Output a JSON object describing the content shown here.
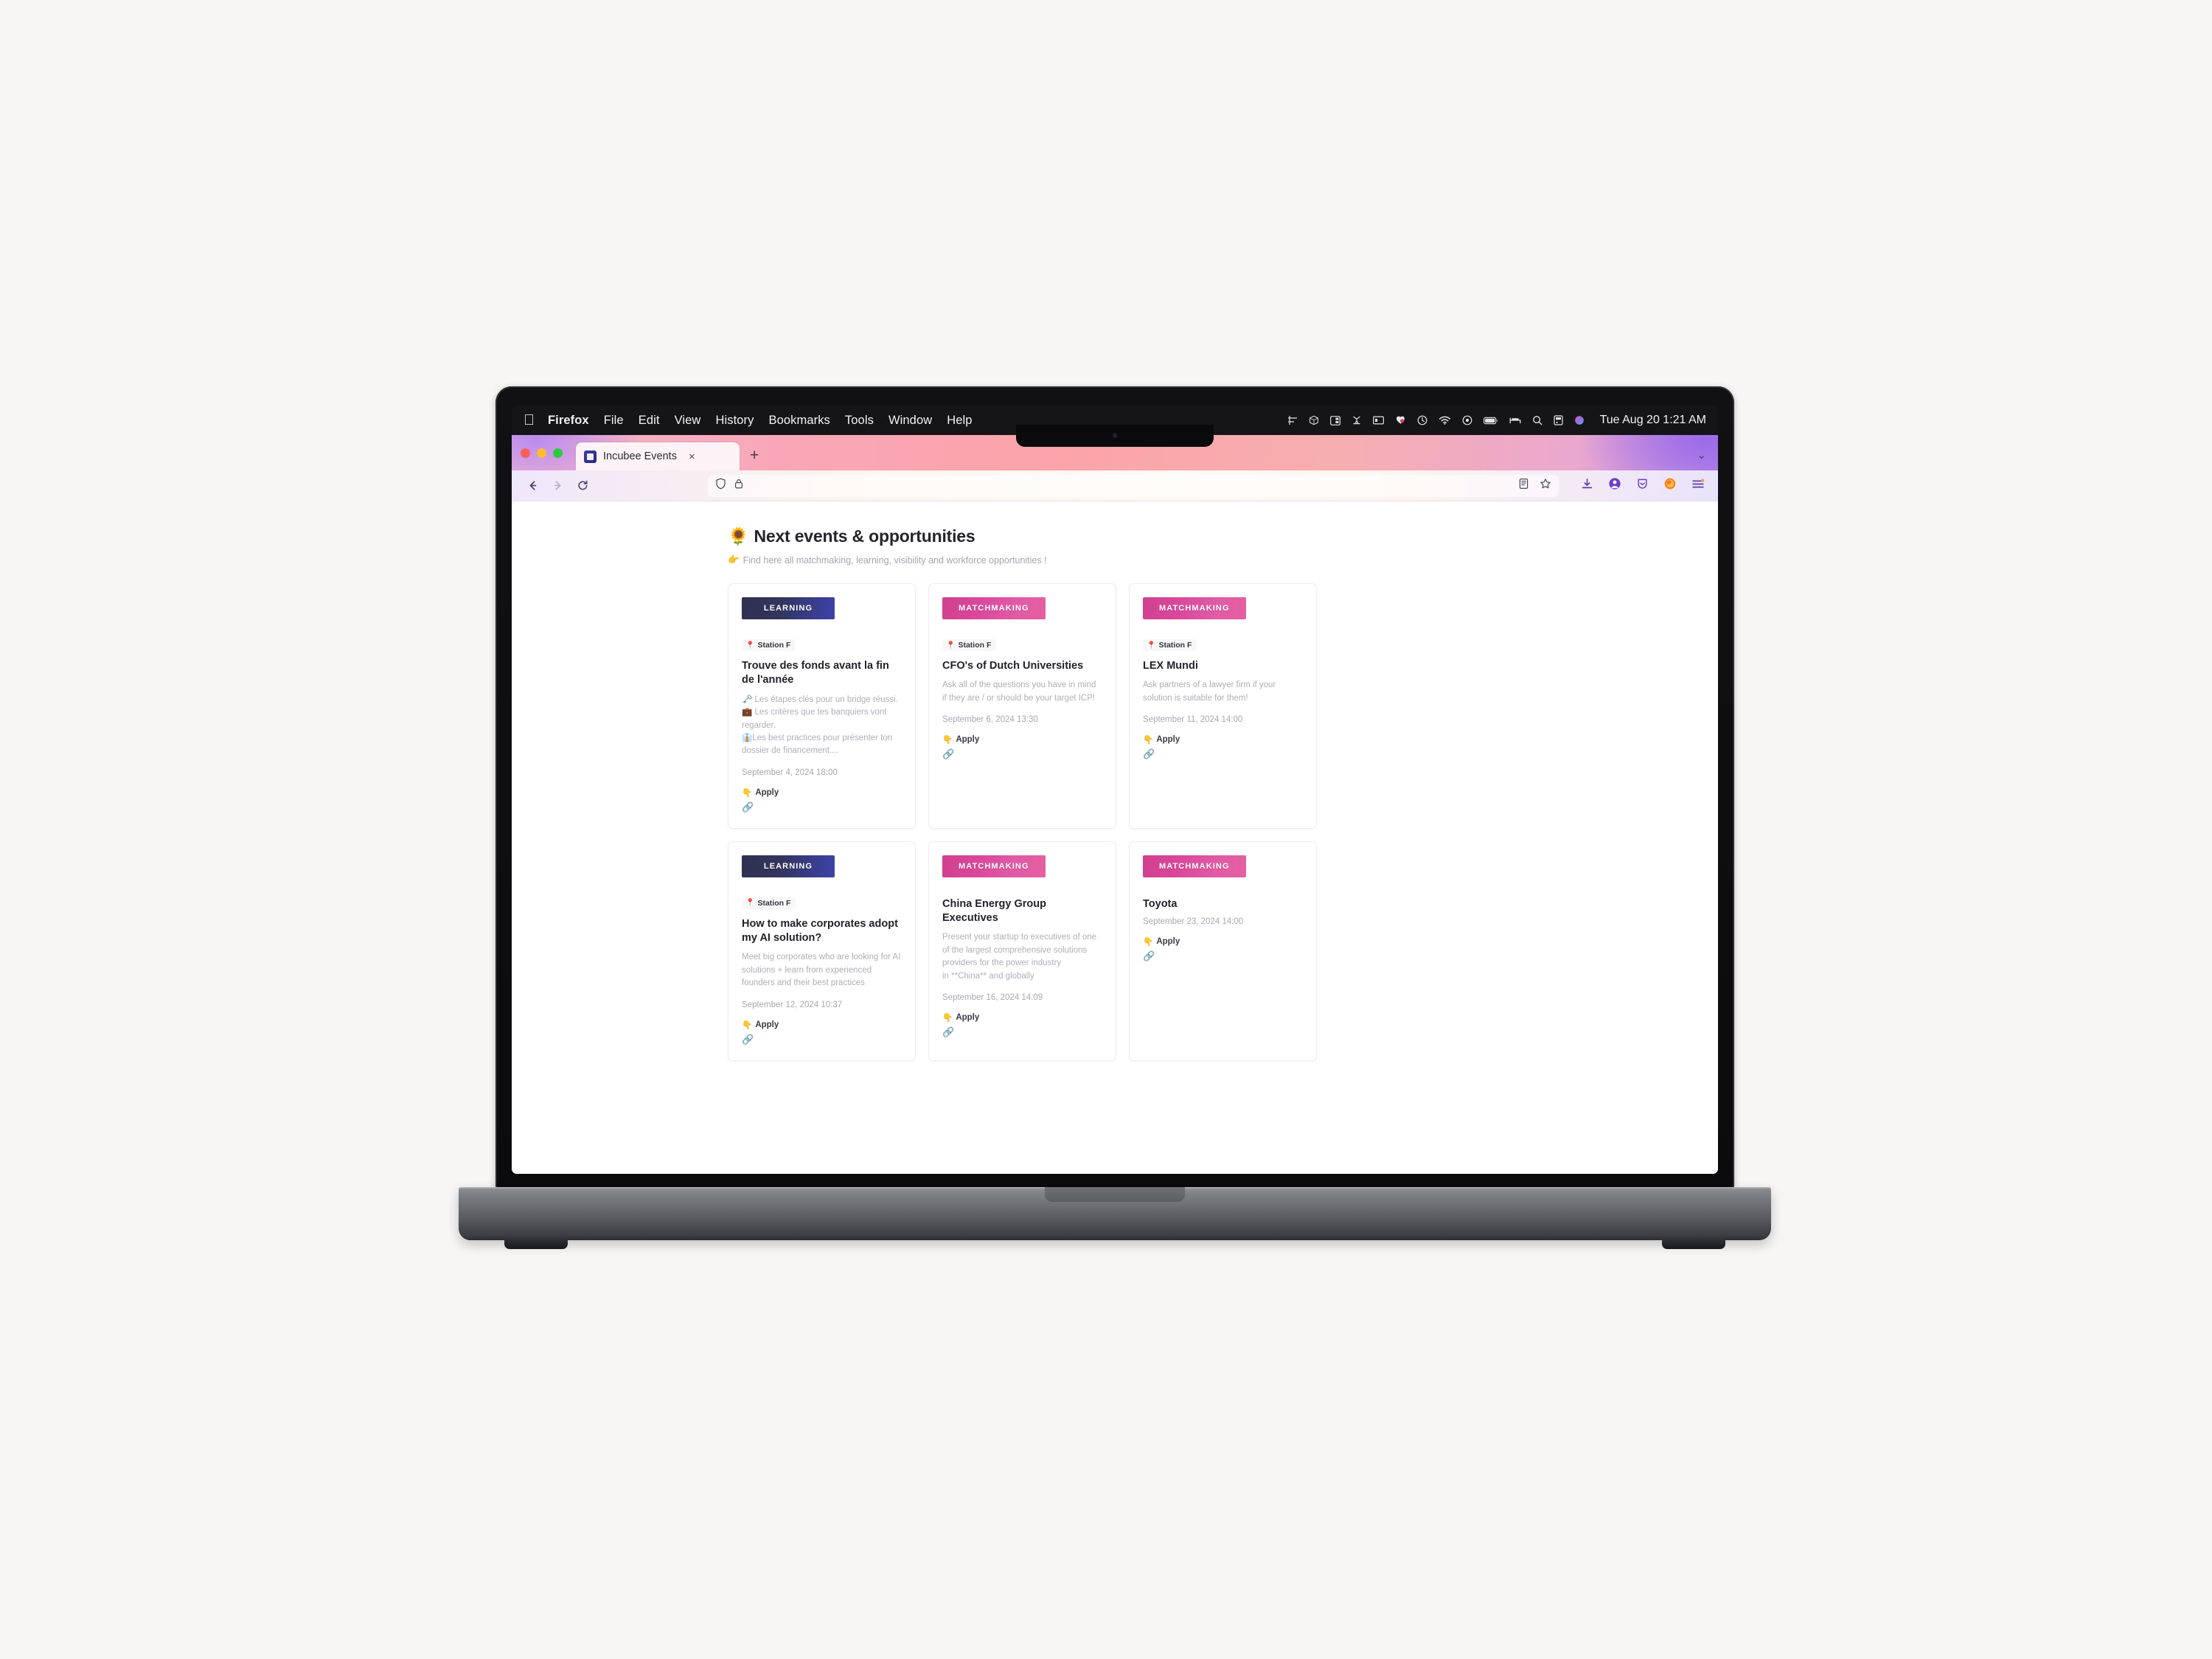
{
  "os": {
    "menubar": {
      "apple_logo": "",
      "items": [
        "Firefox",
        "File",
        "Edit",
        "View",
        "History",
        "Bookmarks",
        "Tools",
        "Window",
        "Help"
      ],
      "tray_icons": [
        "grid-icon",
        "box-icon",
        "sidebar-icon",
        "shortcuts-icon",
        "display-icon",
        "apps-heart-icon",
        "dnd-icon",
        "wifi-icon",
        "control-center-icon",
        "battery-icon",
        "bed-icon",
        "search-icon",
        "screen-share-icon",
        "siri-icon"
      ],
      "clock": "Tue Aug 20  1:21 AM"
    }
  },
  "browser": {
    "traffic_lights": [
      "close",
      "minimize",
      "maximize"
    ],
    "tab": {
      "title": "Incubee Events",
      "favicon": "incubee-favicon",
      "close_label": "×"
    },
    "new_tab_label": "+",
    "tab_list_chevron": "⌄",
    "nav": {
      "back": "←",
      "forward": "→",
      "reload": "⟳"
    },
    "url_bar": {
      "value": "",
      "placeholder": "",
      "shield_icon": "shield-icon",
      "lock_icon": "lock-icon",
      "reader_icon": "reader-mode-icon",
      "bookmark_icon": "star-icon"
    },
    "toolbar_right": [
      "download-icon",
      "account-icon",
      "pocket-icon",
      "firefox-icon",
      "menu-icon"
    ]
  },
  "page": {
    "title_emoji": "🌻",
    "title": "Next events & opportunities",
    "subtitle_emoji": "👉",
    "subtitle": "Find here all matchmaking, learning, visibility and workforce opportunities !",
    "apply_emoji": "👇",
    "apply_label": "Apply",
    "link_icon": "🔗",
    "location_pin": "📍",
    "cards": [
      {
        "badge": "LEARNING",
        "badge_type": "learning",
        "location": "Station F",
        "title": "Trouve des fonds avant la fin de l'année",
        "description": "🗝️ Les étapes clés pour un bridge réussi.\n💼 Les critères que tes banquiers vont regarder.\n👔Les best practices pour présenter ton dossier de financement....",
        "date": "September 4, 2024 18:00"
      },
      {
        "badge": "MATCHMAKING",
        "badge_type": "matchmaking",
        "location": "Station F",
        "title": "CFO's of Dutch Universities",
        "description": "Ask all of the questions you have in mind if they are / or should be your target ICP!",
        "date": "September 6, 2024 13:30"
      },
      {
        "badge": "MATCHMAKING",
        "badge_type": "matchmaking",
        "location": "Station F",
        "title": "LEX Mundi",
        "description": "Ask partners of a lawyer firm if your solution is suitable for them!",
        "date": "September 11, 2024 14:00"
      },
      {
        "badge": "LEARNING",
        "badge_type": "learning",
        "location": "Station F",
        "title": "How to make corporates adopt my AI solution?",
        "description": "Meet big corporates who are looking for AI solutions + learn from experienced founders and their best practices",
        "date": "September 12, 2024 10:37"
      },
      {
        "badge": "MATCHMAKING",
        "badge_type": "matchmaking",
        "location": "",
        "title": "China Energy Group Executives",
        "description": "Present your startup to executives of one of the largest comprehensive solutions providers for the power industry\nin **China** and globally",
        "date": "September 16, 2024 14:09"
      },
      {
        "badge": "MATCHMAKING",
        "badge_type": "matchmaking",
        "location": "",
        "title": "Toyota",
        "description": "",
        "date": "September 23, 2024 14:00"
      }
    ]
  },
  "colors": {
    "badge_learning": "#33355e",
    "badge_matchmaking": "#d9459b",
    "page_bg": "#ffffff",
    "canvas_bg": "#f7f6f5"
  }
}
